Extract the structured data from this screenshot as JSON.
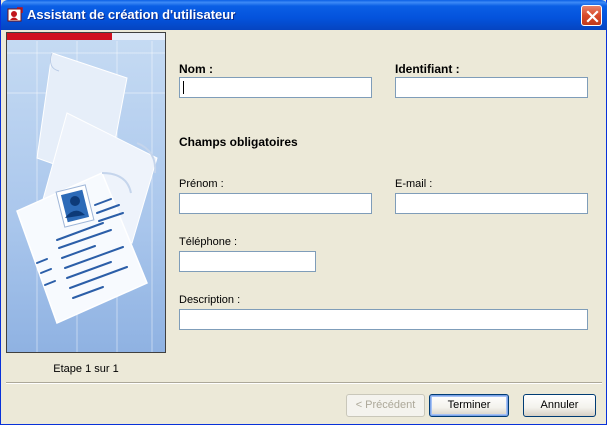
{
  "window": {
    "title": "Assistant de création d'utilisateur"
  },
  "sidebar": {
    "step_label": "Etape 1 sur 1"
  },
  "form": {
    "nom": {
      "label": "Nom :",
      "value": ""
    },
    "identifiant": {
      "label": "Identifiant :",
      "value": ""
    },
    "section_title": "Champs obligatoires",
    "prenom": {
      "label": "Prénom :",
      "value": ""
    },
    "email": {
      "label": "E-mail :",
      "value": ""
    },
    "telephone": {
      "label": "Téléphone :",
      "value": ""
    },
    "description": {
      "label": "Description :",
      "value": ""
    }
  },
  "buttons": {
    "previous": "< Précédent",
    "finish": "Terminer",
    "cancel": "Annuler"
  },
  "colors": {
    "titlebar": "#0a5fe5",
    "dialog_bg": "#ece9d8",
    "accent_red": "#d01020"
  },
  "icons": {
    "title": "user-wizard-icon",
    "close": "close-icon"
  }
}
